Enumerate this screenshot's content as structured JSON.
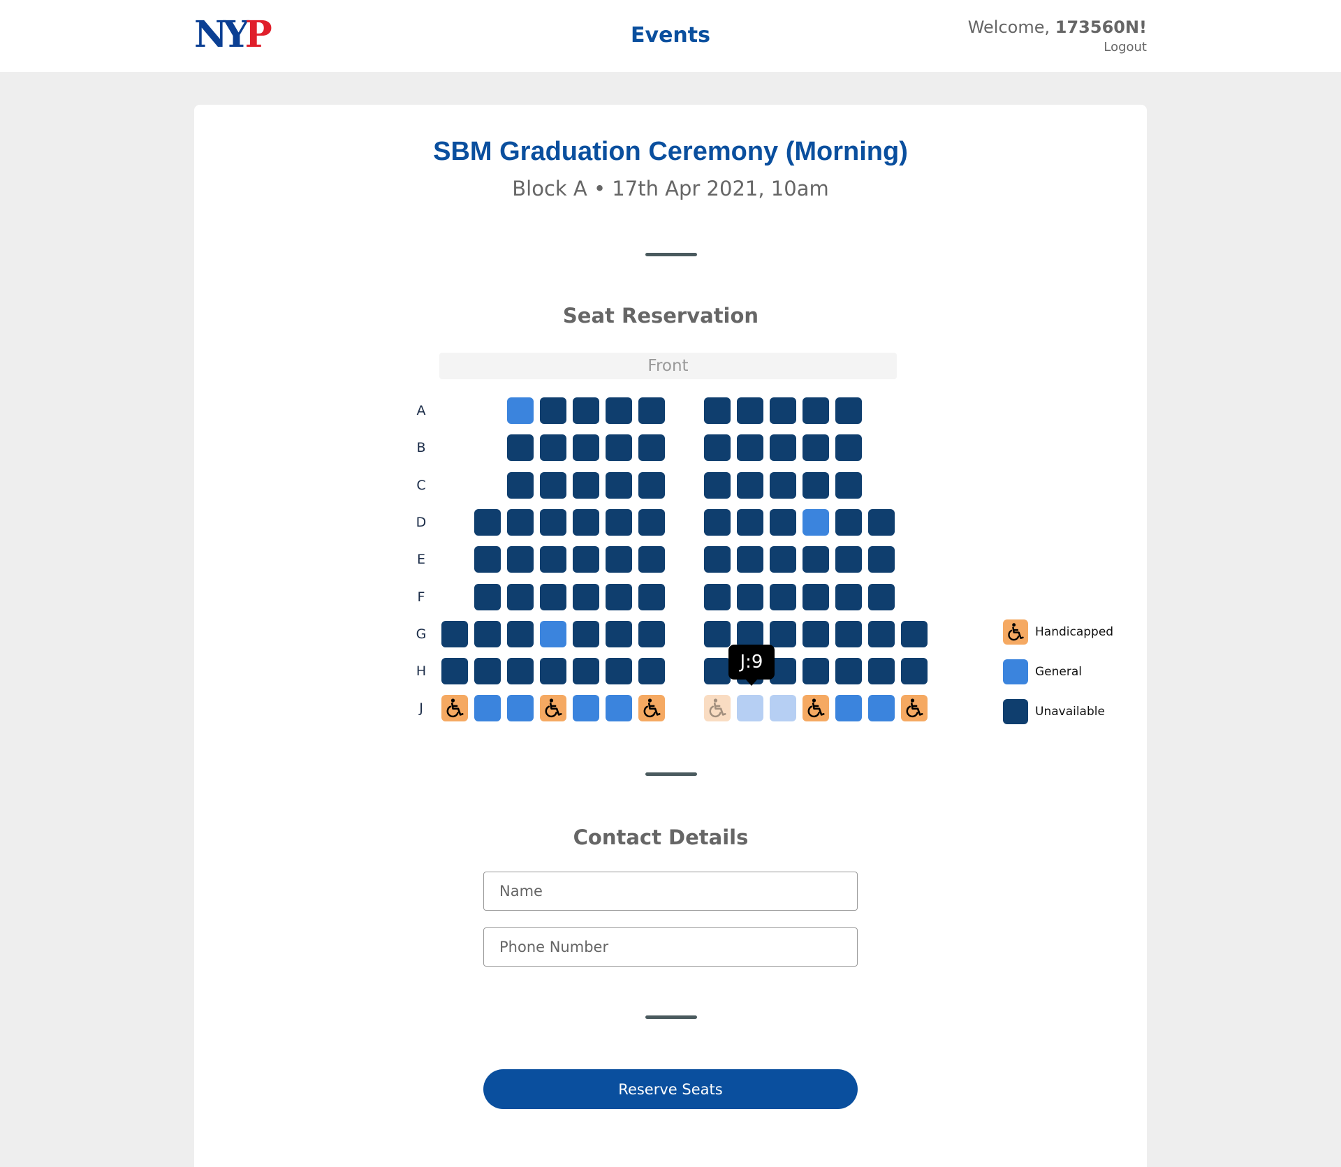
{
  "header": {
    "logo_text_blue": "NY",
    "logo_text_red": "P",
    "nav_title": "Events",
    "welcome_prefix": "Welcome, ",
    "username": "173560N!",
    "logout_label": "Logout"
  },
  "event": {
    "title": "SBM Graduation Ceremony  (Morning)",
    "subtitle": "Block A • 17th Apr 2021, 10am"
  },
  "seat_reservation": {
    "heading": "Seat Reservation",
    "front_label": "Front",
    "rows": [
      {
        "label": "A",
        "left": [
          "none",
          "none",
          "general",
          "unavailable",
          "unavailable",
          "unavailable",
          "unavailable"
        ],
        "right": [
          "unavailable",
          "unavailable",
          "unavailable",
          "unavailable",
          "unavailable",
          "none",
          "none"
        ]
      },
      {
        "label": "B",
        "left": [
          "none",
          "none",
          "unavailable",
          "unavailable",
          "unavailable",
          "unavailable",
          "unavailable"
        ],
        "right": [
          "unavailable",
          "unavailable",
          "unavailable",
          "unavailable",
          "unavailable",
          "none",
          "none"
        ]
      },
      {
        "label": "C",
        "left": [
          "none",
          "none",
          "unavailable",
          "unavailable",
          "unavailable",
          "unavailable",
          "unavailable"
        ],
        "right": [
          "unavailable",
          "unavailable",
          "unavailable",
          "unavailable",
          "unavailable",
          "none",
          "none"
        ]
      },
      {
        "label": "D",
        "left": [
          "none",
          "unavailable",
          "unavailable",
          "unavailable",
          "unavailable",
          "unavailable",
          "unavailable"
        ],
        "right": [
          "unavailable",
          "unavailable",
          "unavailable",
          "general",
          "unavailable",
          "unavailable",
          "none"
        ]
      },
      {
        "label": "E",
        "left": [
          "none",
          "unavailable",
          "unavailable",
          "unavailable",
          "unavailable",
          "unavailable",
          "unavailable"
        ],
        "right": [
          "unavailable",
          "unavailable",
          "unavailable",
          "unavailable",
          "unavailable",
          "unavailable",
          "none"
        ]
      },
      {
        "label": "F",
        "left": [
          "none",
          "unavailable",
          "unavailable",
          "unavailable",
          "unavailable",
          "unavailable",
          "unavailable"
        ],
        "right": [
          "unavailable",
          "unavailable",
          "unavailable",
          "unavailable",
          "unavailable",
          "unavailable",
          "none"
        ]
      },
      {
        "label": "G",
        "left": [
          "unavailable",
          "unavailable",
          "unavailable",
          "general",
          "unavailable",
          "unavailable",
          "unavailable"
        ],
        "right": [
          "unavailable",
          "unavailable",
          "unavailable",
          "unavailable",
          "unavailable",
          "unavailable",
          "unavailable"
        ]
      },
      {
        "label": "H",
        "left": [
          "unavailable",
          "unavailable",
          "unavailable",
          "unavailable",
          "unavailable",
          "unavailable",
          "unavailable"
        ],
        "right": [
          "unavailable",
          "unavailable",
          "unavailable",
          "unavailable",
          "unavailable",
          "unavailable",
          "unavailable"
        ]
      },
      {
        "label": "J",
        "left": [
          "handicapped",
          "general",
          "general",
          "handicapped",
          "general",
          "general",
          "handicapped"
        ],
        "right": [
          "handicapped-selected",
          "general-selected",
          "general-selected",
          "handicapped",
          "general",
          "general",
          "handicapped"
        ]
      }
    ],
    "tooltip": "J:9",
    "legend": [
      {
        "type": "handicapped",
        "label": "Handicapped"
      },
      {
        "type": "general",
        "label": "General"
      },
      {
        "type": "unavailable",
        "label": "Unavailable"
      }
    ],
    "icon": "wheelchair-icon"
  },
  "contact": {
    "heading": "Contact Details",
    "name_placeholder": "Name",
    "name_value": "",
    "phone_placeholder": "Phone Number",
    "phone_value": ""
  },
  "actions": {
    "reserve_label": "Reserve Seats"
  },
  "colors": {
    "brand_blue": "#0a4f9e",
    "unavailable": "#0f3e6e",
    "general": "#3b84dd",
    "handicapped": "#f5a962",
    "selected_general": "#b6cff3",
    "selected_handicapped": "#f9dcc2"
  }
}
